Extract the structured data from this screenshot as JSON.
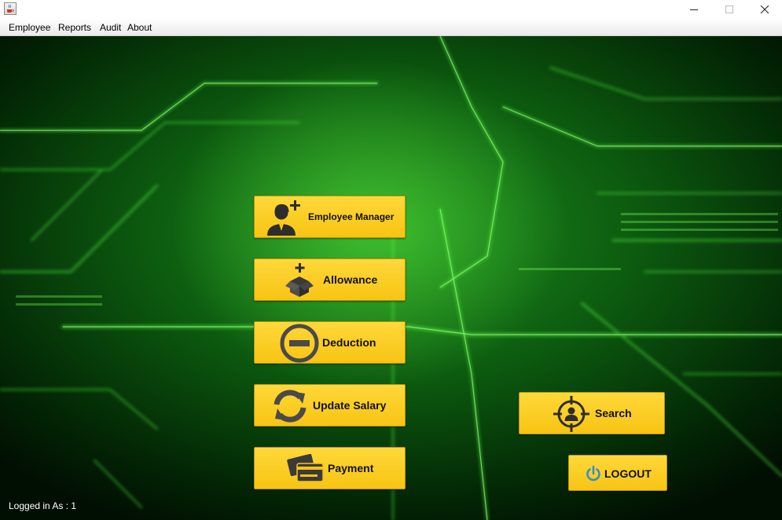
{
  "window": {
    "icon": "java-cup-icon",
    "controls": [
      "minimize-icon",
      "maximize-icon",
      "close-icon"
    ]
  },
  "menubar": {
    "items": [
      {
        "label": "Employee"
      },
      {
        "label": "Reports"
      },
      {
        "label": "Audit"
      },
      {
        "label": "About"
      }
    ]
  },
  "buttons": {
    "employee_manager": {
      "label": "Employee Manager",
      "icon": "add-user-icon"
    },
    "allowance": {
      "label": "Allowance",
      "icon": "add-package-icon"
    },
    "deduction": {
      "label": "Deduction",
      "icon": "minus-circle-icon"
    },
    "update_salary": {
      "label": "Update Salary",
      "icon": "refresh-icon"
    },
    "payment": {
      "label": "Payment",
      "icon": "credit-card-icon"
    },
    "search": {
      "label": "Search",
      "icon": "target-user-icon"
    },
    "logout": {
      "label": "LOGOUT",
      "icon": "power-icon"
    }
  },
  "status": {
    "text": "Logged in As : 1"
  },
  "colors": {
    "button_bg": "#f7c413",
    "icon_dark": "#4a4a4a",
    "power_blue": "#2f8fd8",
    "background_green": "#0c5a0f"
  }
}
